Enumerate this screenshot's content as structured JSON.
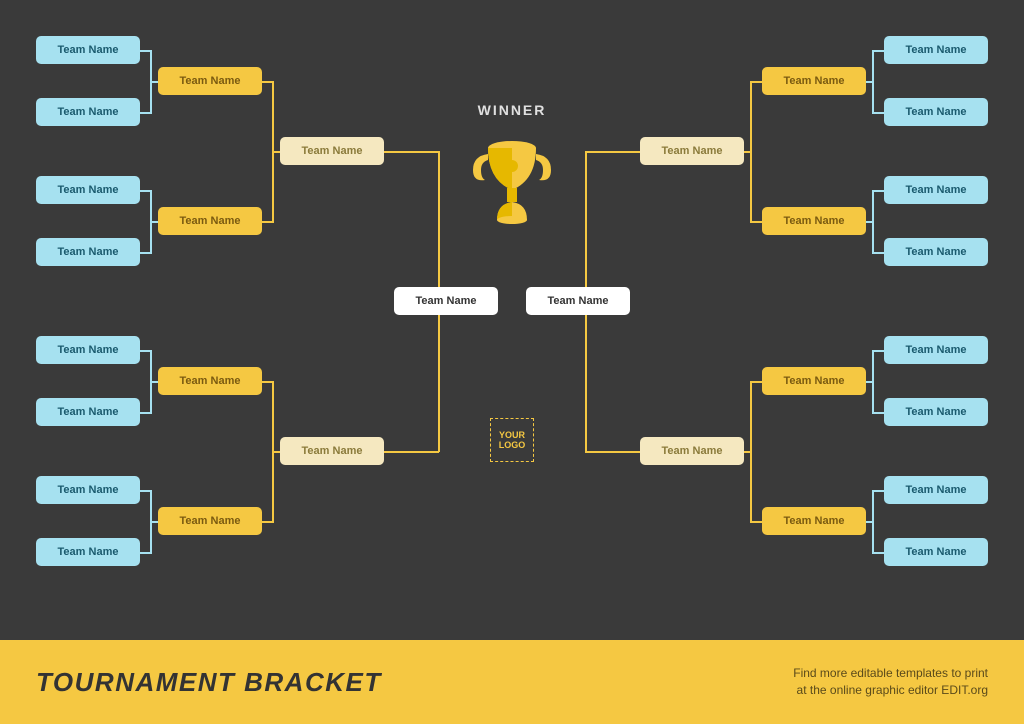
{
  "winner_label": "WINNER",
  "logo_text": "YOUR LOGO",
  "footer": {
    "title": "TOURNAMENT BRACKET",
    "sub1": "Find more editable templates to print",
    "sub2": "at the online graphic editor EDIT.org"
  },
  "left": {
    "r16": [
      "Team Name",
      "Team Name",
      "Team Name",
      "Team Name",
      "Team Name",
      "Team Name",
      "Team Name",
      "Team Name"
    ],
    "r8": [
      "Team Name",
      "Team Name",
      "Team Name",
      "Team Name"
    ],
    "r4": [
      "Team Name",
      "Team Name"
    ],
    "r2": "Team Name"
  },
  "right": {
    "r16": [
      "Team Name",
      "Team Name",
      "Team Name",
      "Team Name",
      "Team Name",
      "Team Name",
      "Team Name",
      "Team Name"
    ],
    "r8": [
      "Team Name",
      "Team Name",
      "Team Name",
      "Team Name"
    ],
    "r4": [
      "Team Name",
      "Team Name"
    ],
    "r2": "Team Name"
  },
  "colors": {
    "dark": "#3a3a3a",
    "gold": "#f5c842",
    "cyan": "#a6e1f0",
    "cream": "#f5e8c0"
  }
}
